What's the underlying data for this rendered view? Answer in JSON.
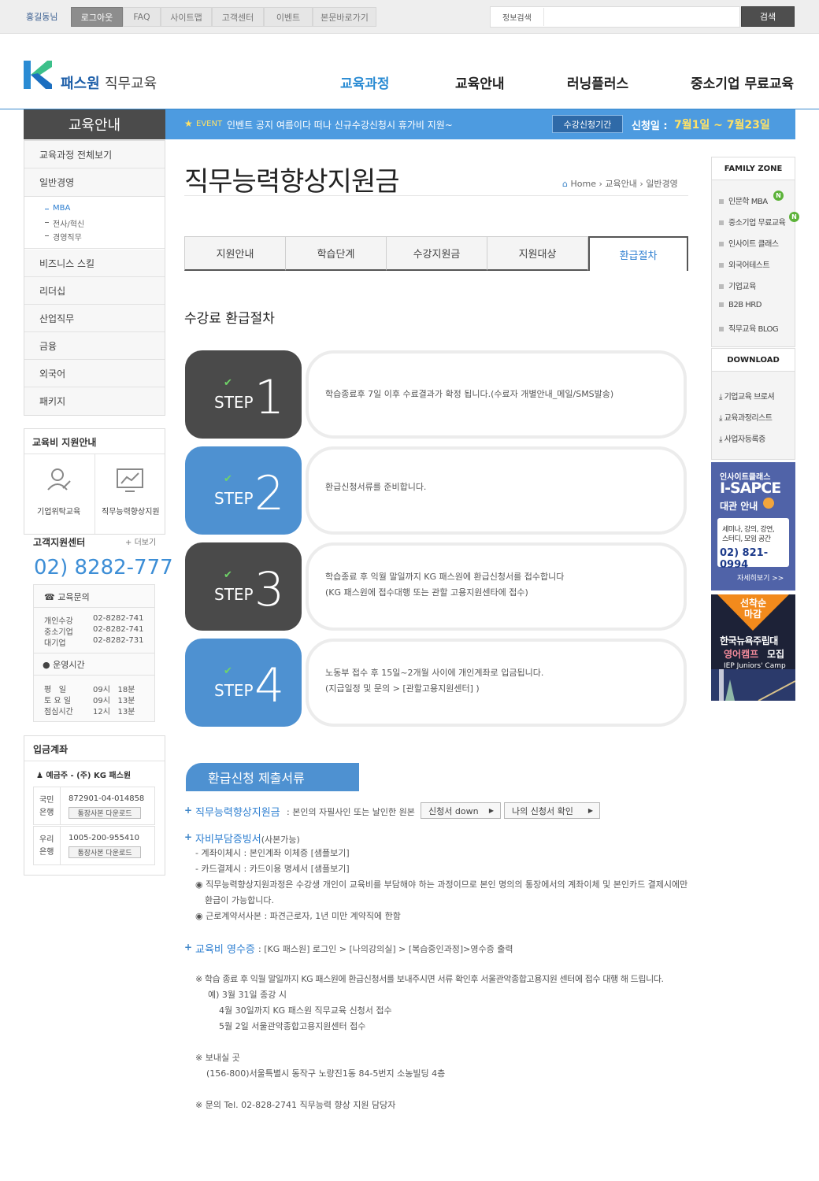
{
  "topbar": {
    "user": "홍길동님",
    "buttons": [
      "로그아웃",
      "FAQ",
      "사이트맵",
      "고객센터",
      "이벤트",
      "본문바로가기"
    ],
    "search_label": "정보검색",
    "search_placeholder": "",
    "search_button": "검색"
  },
  "header": {
    "logo_main": "패스원",
    "logo_sub": "직무교육",
    "nav": [
      "교육과정",
      "교육안내",
      "러닝플러스",
      "중소기업 무료교육"
    ],
    "active_nav": "교육과정"
  },
  "subheader": {
    "side_title": "교육안내",
    "event_tag": "EVENT",
    "event_text": "인벤트 공지 여름이다 떠나  신규수강신청시 휴가비 지원~",
    "period_badge": "수강신청기간",
    "apply_label": "신청일 :",
    "apply_date": "7월1일 ~ 7월23일"
  },
  "lnb": {
    "items": [
      "교육과정 전체보기",
      "일반경영",
      "비즈니스 스킬",
      "리더십",
      "산업직무",
      "금융",
      "외국어",
      "패키지"
    ],
    "subitems": [
      "MBA",
      "전사/혁신",
      "경영직무"
    ],
    "active_sub": "MBA"
  },
  "support": {
    "title": "교육비 지원안내",
    "cards": [
      "기업위탁교육",
      "직무능력향상지원"
    ]
  },
  "customer_center": {
    "title": "고객지원센터",
    "more": "더보기",
    "phone": "02) 8282-777",
    "inquiry_title": "교육문의",
    "inquiry": [
      {
        "label": "개인수강",
        "value": "02-8282-741"
      },
      {
        "label": "중소기업",
        "value": "02-8282-741"
      },
      {
        "label": "대기업",
        "value": "02-8282-731"
      }
    ],
    "hours_title": "운영시간",
    "hours": [
      {
        "label": "평   일",
        "value": "09시   18분"
      },
      {
        "label": "토 요 일",
        "value": "09시   13분"
      },
      {
        "label": "점심시간",
        "value": "12시   13분"
      }
    ]
  },
  "bank": {
    "title": "입금계좌",
    "holder": "예금주 - (주) KG 패스원",
    "accounts": [
      {
        "bank1": "국민",
        "bank2": "은행",
        "number": "872901-04-014858",
        "download": "통장사본 다운로드"
      },
      {
        "bank1": "우리",
        "bank2": "은행",
        "number": "1005-200-955410",
        "download": "통장사본 다운로드"
      }
    ]
  },
  "main": {
    "title": "직무능력향상지원금",
    "breadcrumb": [
      "Home",
      "교육안내",
      "일반경영"
    ],
    "tabs": [
      "지원안내",
      "학습단계",
      "수강지원금",
      "지원대상",
      "환급절차"
    ],
    "active_tab": "환급절차",
    "section_title": "수강료 환급절차",
    "steps": [
      {
        "word": "STEP",
        "num": "1",
        "lines": [
          "학습종료후 7일 이후 수료결과가 확정 됩니다.(수료자 개별안내_메일/SMS발송)"
        ],
        "color": "#4a4a4a"
      },
      {
        "word": "STEP",
        "num": "2",
        "lines": [
          "환급신청서류를 준비합니다."
        ],
        "color": "#4e91d1"
      },
      {
        "word": "STEP",
        "num": "3",
        "lines": [
          "학습종료 후 익월 말일까지 KG 패스원에 환급신청서를 접수합니다",
          "(KG 패스원에 접수대행 또는 관할 고용지원센타에 접수)"
        ],
        "color": "#4a4a4a"
      },
      {
        "word": "STEP",
        "num": "4",
        "lines": [
          "노동부 접수 후 15일~2개월 사이에 개인계좌로 입금됩니다.",
          "(지급일정 및 문의 > [관할고용지원센터] )"
        ],
        "color": "#4e91d1"
      }
    ],
    "docs_title": "환급신청 제출서류",
    "doc1_head": "직무능력향상지원금",
    "doc1_desc": ": 본인의 자필사인 또는 날인한 원본",
    "doc1_btn1": "신청서 down",
    "doc1_btn2": "나의 신청서 확인",
    "doc2_head": "자비부담증빙서",
    "doc2_note": "(사본가능)",
    "doc2_lines": [
      "- 계좌이체시 : 본인계좌 이체증 [샘플보기]",
      "- 카드결제시 : 카드이용 명세서 [샘플보기]"
    ],
    "doc2_bullets": [
      "직무능력향상지원과정은 수강생 개인이 교육비를 부담해야 하는 과정이므로 본인 명의의 통장에서의 계좌이체 및 본인카드 결제시에만",
      "근로계약서사본 : 파견근로자, 1년 미만 계약직에 한함"
    ],
    "doc2_bullet1_cont": "환급이 가능합니다.",
    "doc3_head": "교육비 영수증",
    "doc3_desc": ": [KG 패스원] 로그인 > [나의강의실] > [복습중인과정]>영수증 출력",
    "notes": [
      "※ 학습 종료 후 익월 말일까지 KG 패스원에 환급신청서를 보내주시면 서류 확인후 서울관악종합고용지원 센터에 접수 대행 해 드립니다.",
      "예) 3월 31일 종강 시",
      "4월 30일까지 KG 패스원 직무교육 신청서 접수",
      "5월 2일 서울관악종합고용지원센터 접수",
      "※ 보내실 곳",
      "(156-800)서울특별시 동작구 노량진1동 84-5번지 소농빌딩 4층",
      "※ 문의 Tel. 02-828-2741 직무능력 향상 지원 담당자"
    ]
  },
  "right": {
    "family_title": "FAMILY ZONE",
    "family": [
      "인문학 MBA",
      "중소기업 무료교육",
      "인사이트 클래스",
      "외국어테스트",
      "기업교육",
      "B2B HRD",
      "직무교육 BLOG"
    ],
    "new_badge": "N",
    "download_title": "DOWNLOAD",
    "downloads": [
      "기업교육 브로셔",
      "교육과정리스트",
      "사업자등록증"
    ],
    "banner1": {
      "l1": "인사이트클래스",
      "l2": "I-SAPCE",
      "l3": "대관 안내",
      "l4": "세미나, 강의, 강연,",
      "l5": "스터디, 모임 공간",
      "phone": "02) 821-0994",
      "more": "자세히보기 >>"
    },
    "banner2": {
      "l1": "선착순",
      "l2": "마감",
      "l3": "한국뉴욕주립대",
      "l4": "영어캠프",
      "l5": "모집",
      "l6": "IEP Juniors' Camp"
    }
  }
}
